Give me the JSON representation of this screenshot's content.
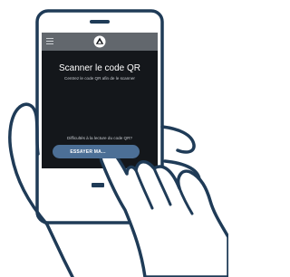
{
  "colors": {
    "outline": "#1f3b57",
    "screen": "#14171b",
    "appbar": "#62676d",
    "button": "#4c6f96",
    "background": "#ffffff"
  },
  "icons": {
    "menu": "hamburger-menu-icon",
    "logo": "app-logo-icon"
  },
  "scanner": {
    "title": "Scanner le code QR",
    "subtitle": "Centrez le code QR afin de le scanner",
    "help_link": "Difficultés à la lecture du code QR?",
    "retry_button": "ESSAYER MA..."
  }
}
